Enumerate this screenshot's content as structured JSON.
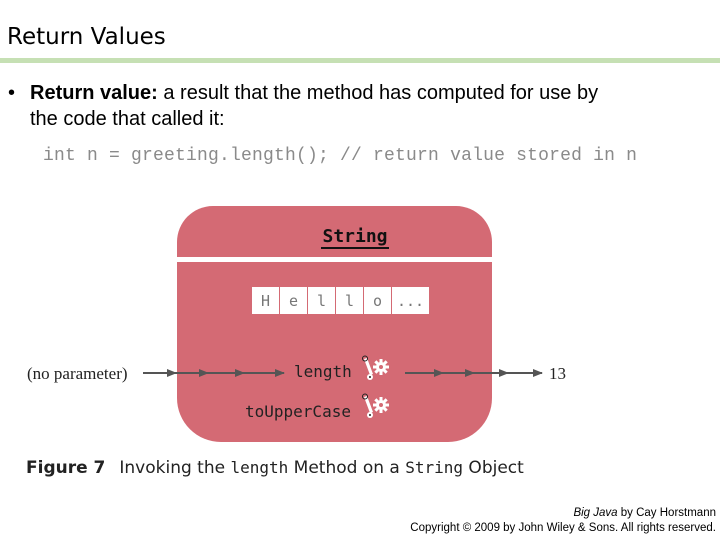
{
  "slide": {
    "title": "Return Values",
    "bullet": {
      "marker": "•",
      "term": "Return value:",
      "text_line1": " a result that the method has computed for use by",
      "text_line2": "the code that called it:"
    },
    "code_line": "int n = greeting.length(); // return value stored in n"
  },
  "figure": {
    "class_name": "String",
    "characters": [
      "H",
      "e",
      "l",
      "l",
      "o",
      "..."
    ],
    "methods": [
      {
        "name": "length",
        "icon": "gear-lever-icon"
      },
      {
        "name": "toUpperCase",
        "icon": "gear-lever-icon"
      }
    ],
    "input_label": "(no parameter)",
    "output_label": "13",
    "colors": {
      "object_fill": "#d46a74",
      "arrow": "#555555",
      "title_rule": "#c6e0b4"
    },
    "caption": {
      "figure_label": "Figure 7",
      "text_before": "Invoking the ",
      "code1": "length",
      "text_middle": " Method on a ",
      "code2": "String",
      "text_after": " Object"
    }
  },
  "footer": {
    "book_title": "Big Java",
    "book_author": " by Cay Horstmann",
    "copyright": "Copyright © 2009 by John Wiley & Sons.  All rights reserved."
  }
}
